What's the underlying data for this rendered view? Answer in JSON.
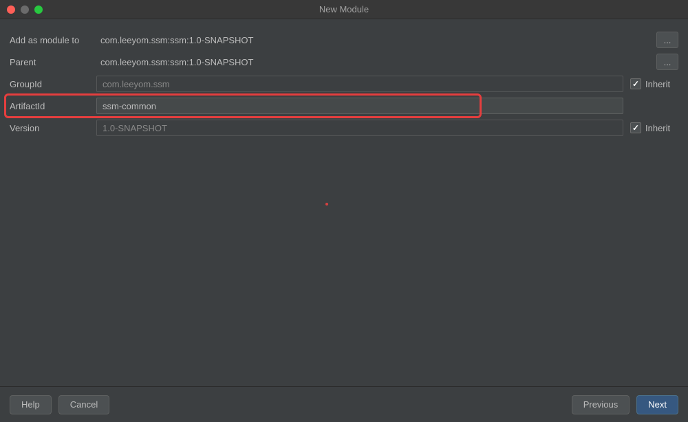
{
  "window": {
    "title": "New Module"
  },
  "form": {
    "add_as_module_to": {
      "label": "Add as module to",
      "value": "com.leeyom.ssm:ssm:1.0-SNAPSHOT",
      "browse": "..."
    },
    "parent": {
      "label": "Parent",
      "value": "com.leeyom.ssm:ssm:1.0-SNAPSHOT",
      "browse": "..."
    },
    "group_id": {
      "label": "GroupId",
      "value": "com.leeyom.ssm",
      "inherit_label": "Inherit",
      "inherit_checked": true
    },
    "artifact_id": {
      "label": "ArtifactId",
      "value": "ssm-common"
    },
    "version": {
      "label": "Version",
      "value": "1.0-SNAPSHOT",
      "inherit_label": "Inherit",
      "inherit_checked": true
    }
  },
  "footer": {
    "help": "Help",
    "cancel": "Cancel",
    "previous": "Previous",
    "next": "Next"
  }
}
